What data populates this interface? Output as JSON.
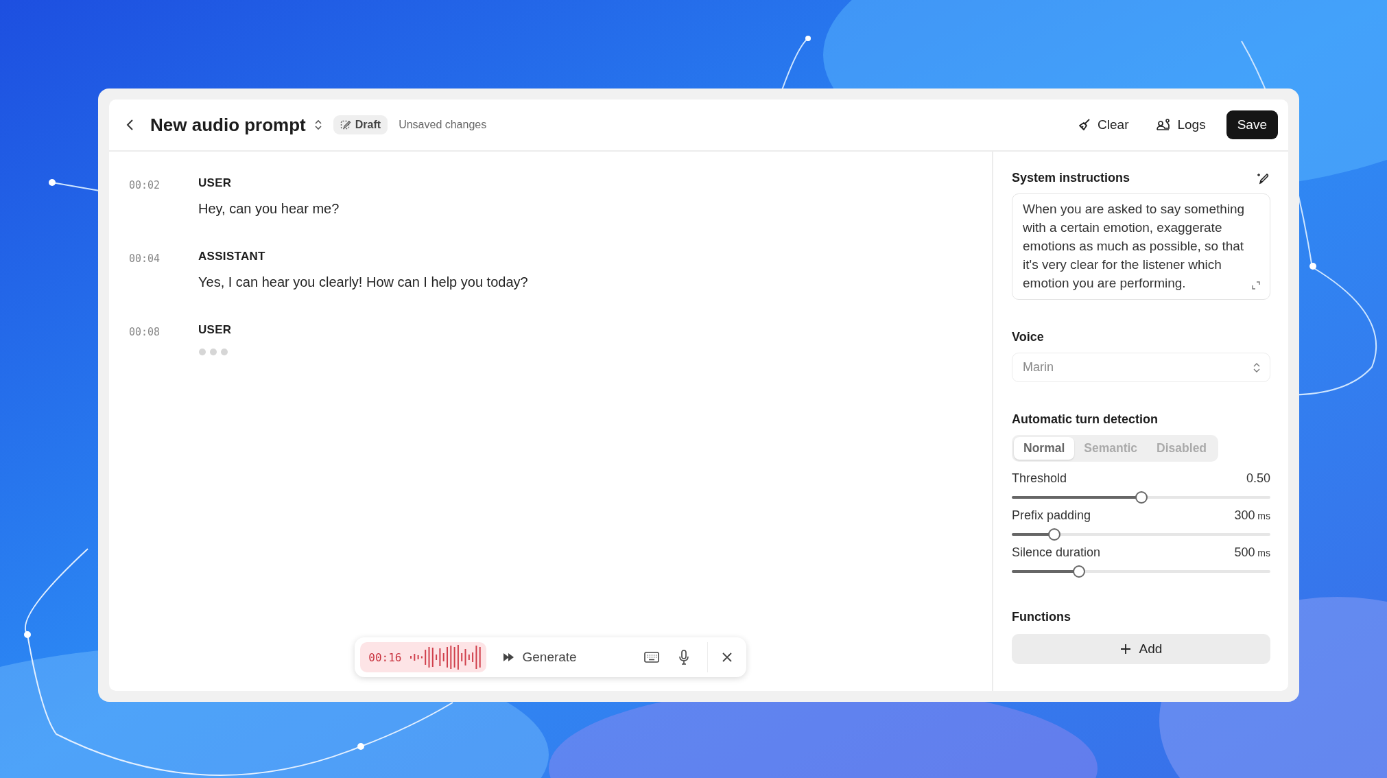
{
  "header": {
    "title": "New audio prompt",
    "badge": "Draft",
    "status": "Unsaved changes",
    "buttons": [
      {
        "label": "Clear",
        "kind": "clear"
      },
      {
        "label": "Logs",
        "kind": "logs"
      },
      {
        "label": "Save",
        "kind": "primary"
      }
    ]
  },
  "messages": [
    {
      "time": "00:02",
      "role": "USER",
      "text": "Hey, can you hear me?",
      "typing": false
    },
    {
      "time": "00:04",
      "role": "ASSISTANT",
      "text": "Yes, I can hear you clearly! How can I help you today?",
      "typing": false
    },
    {
      "time": "00:08",
      "role": "USER",
      "typing": true
    }
  ],
  "composer": {
    "timer": "00:16",
    "generate": "Generate"
  },
  "settings": {
    "instructions_label": "System instructions",
    "instructions": "When you are asked to say something with a certain emotion, exaggerate emotions as much as possible, so that it's very clear for the listener which emotion you are performing.",
    "voice_label": "Voice",
    "voice": "Marin",
    "turn_label": "Automatic turn detection",
    "modes": [
      {
        "label": "Normal",
        "selected": true
      },
      {
        "label": "Semantic",
        "selected": false
      },
      {
        "label": "Disabled",
        "selected": false
      }
    ],
    "sliders": [
      {
        "label": "Threshold",
        "value": "0.50",
        "level": 0.5
      },
      {
        "label": "Prefix padding",
        "value": "300",
        "unit": "ms",
        "level": 0.165
      },
      {
        "label": "Silence duration",
        "value": "500",
        "unit": "ms",
        "level": 0.26
      }
    ],
    "functions_label": "Functions",
    "add": "Add"
  }
}
